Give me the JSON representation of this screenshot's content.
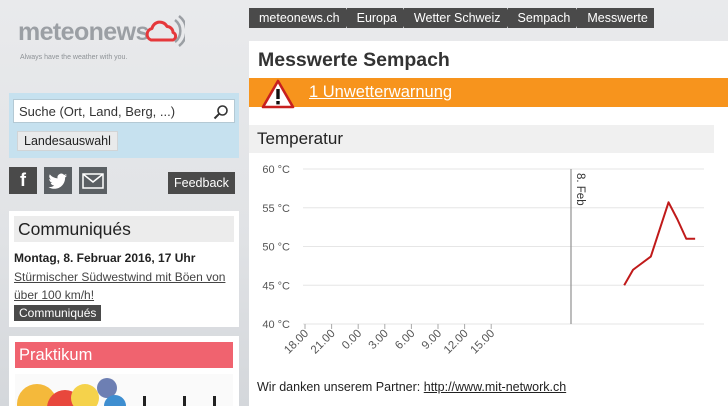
{
  "logo": {
    "name": "meteonews",
    "tagline": "Always have the weather with you."
  },
  "search": {
    "placeholder": "Suche (Ort, Land, Berg, ...)",
    "country_button": "Landesauswahl"
  },
  "social": {
    "feedback": "Feedback",
    "icons": [
      "facebook-icon",
      "twitter-icon",
      "mail-icon"
    ]
  },
  "communiques": {
    "title": "Communiqués",
    "date": "Montag, 8. Februar 2016, 17 Uhr",
    "headline": "Stürmischer Südwestwind mit Böen von über 100 km/h!",
    "button": "Communiqués"
  },
  "praktikum": {
    "title": "Praktikum"
  },
  "breadcrumb": [
    "meteonews.ch",
    "Europa",
    "Wetter Schweiz",
    "Sempach",
    "Messwerte"
  ],
  "page": {
    "title": "Messwerte Sempach"
  },
  "warning": {
    "text": "1 Unwetterwarnung"
  },
  "temperature": {
    "title": "Temperatur",
    "partner_prefix": "Wir danken unserem Partner:",
    "partner_link": "http://www.mit-network.ch"
  },
  "colors": {
    "warning": "#f7941d",
    "line": "#c01a1a",
    "praktikum": "#f0636f",
    "search_bg": "#c6e1ef"
  },
  "chart_data": {
    "type": "line",
    "ylabel": "",
    "xlabel": "",
    "ylim": [
      40,
      60
    ],
    "yticks": [
      "60 °C",
      "55 °C",
      "50 °C",
      "45 °C",
      "40 °C"
    ],
    "xticks": [
      "18.00",
      "21.00",
      "0.00",
      "3.00",
      "6.00",
      "9.00",
      "12.00",
      "15.00"
    ],
    "day_marker": {
      "label": "8. Feb",
      "x_hours": 30
    },
    "series": [
      {
        "x_hours": [
          36,
          37,
          39,
          41,
          42,
          43,
          44
        ],
        "y": [
          45.0,
          47.0,
          48.7,
          55.7,
          53.5,
          51.0,
          51.0
        ]
      }
    ],
    "grid": true
  }
}
